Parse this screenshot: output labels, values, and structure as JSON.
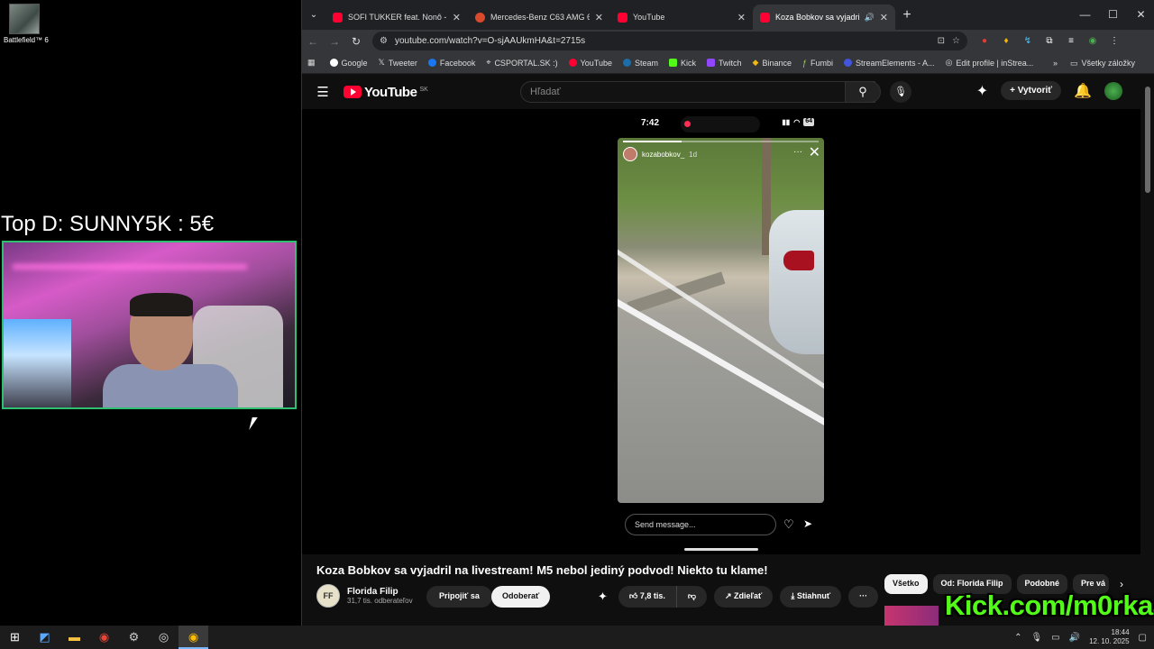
{
  "desktop": {
    "icon_label": "Battlefield™ 6",
    "donation_text": "Top D: SUNNY5K : 5€"
  },
  "browser": {
    "tabs": [
      {
        "title": "SOFI TUKKER feat. Nonô - \"Pick",
        "icon": "youtube-icon"
      },
      {
        "title": "Mercedes-Benz C63 AMG 6.2 V",
        "icon": "mercedes-icon"
      },
      {
        "title": "YouTube",
        "icon": "youtube-icon"
      },
      {
        "title": "Koza Bobkov sa vyjadril na",
        "icon": "youtube-icon"
      }
    ],
    "url": "youtube.com/watch?v=O-sjAAUkmHA&t=2715s",
    "bookmarks": [
      "Google",
      "Tweeter",
      "Facebook",
      "CSPORTAL.SK :)",
      "YouTube",
      "Steam",
      "Kick",
      "Twitch",
      "Binance",
      "Fumbi",
      "StreamElements - A...",
      "Edit profile | inStrea..."
    ],
    "bookmarks_more": "»",
    "all_bookmarks": "Všetky záložky"
  },
  "youtube": {
    "logo_text": "YouTube",
    "region": "SK",
    "search_placeholder": "Hľadať",
    "create_label": "Vytvoriť",
    "video_title": "Koza Bobkov sa vyjadril na livestream! M5 nebol jediný podvod! Niekto tu klame!",
    "channel_name": "Florida Filip",
    "channel_subs": "31,7 tis. odberateľov",
    "join_label": "Pripojiť sa",
    "unsubscribe_label": "Odoberať",
    "like_count": "7,8 tis.",
    "share_label": "Zdieľať",
    "download_label": "Stiahnuť",
    "chips": [
      "Všetko",
      "Od: Florida Filip",
      "Podobné",
      "Pre vá"
    ]
  },
  "phone": {
    "time": "7:42",
    "battery": "64",
    "story_user": "kozabobkov_",
    "story_age": "1d",
    "message_placeholder": "Send message..."
  },
  "overlay": {
    "kick_text": "Kick.com/m0rkaa"
  },
  "taskbar": {
    "time": "18:44",
    "date": "12. 10. 2025"
  }
}
